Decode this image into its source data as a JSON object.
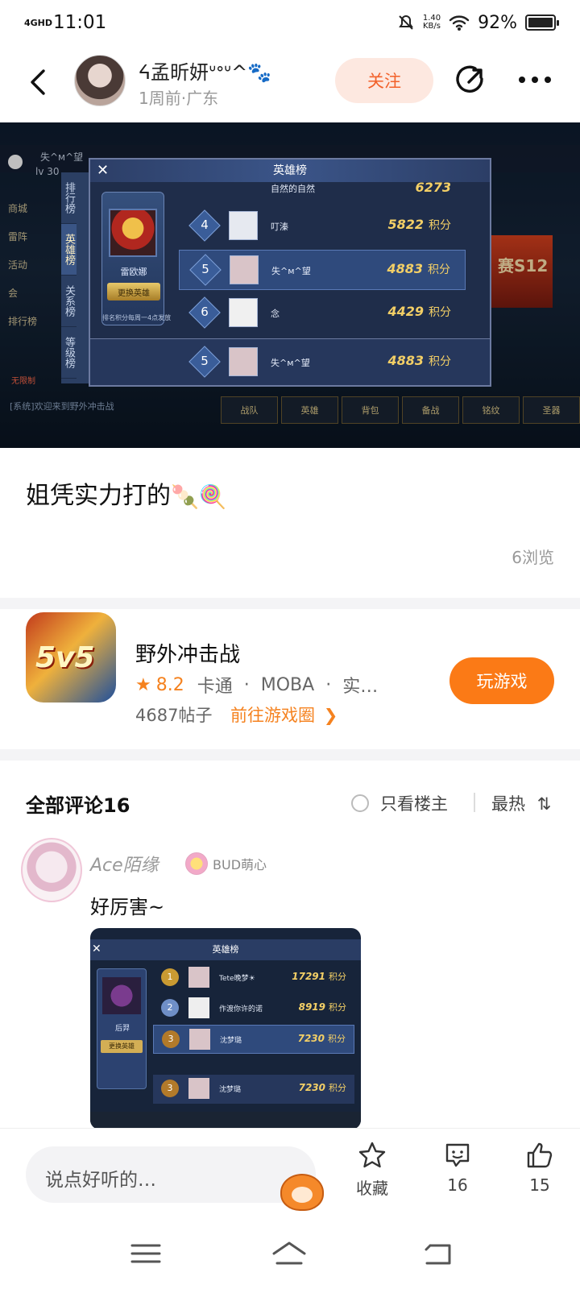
{
  "status_bar": {
    "network": "4GHD",
    "time": "11:01",
    "speed_value": "1.40",
    "speed_unit": "KB/s",
    "battery": "92%",
    "battery_level": 0.92
  },
  "header": {
    "user_name": "ᔦ孟昕妍ᐡᐤᐡ^🐾",
    "post_meta": "1周前·广东",
    "follow_label": "关注"
  },
  "game_shot": {
    "top_player": "失^м^望",
    "level": "lv 30",
    "side_tabs": [
      "排行榜",
      "英雄榜",
      "关系榜",
      "等级榜"
    ],
    "panel_title": "英雄榜",
    "hero_name": "雷欧娜",
    "swap_hero": "更换英雄",
    "rank_note": "排名积分每周一4点发放",
    "top_row_name": "自然的自然",
    "top_row_score": "6273",
    "rows": [
      {
        "rank": "4",
        "name": "叮溱",
        "score": "5822",
        "unit": "积分"
      },
      {
        "rank": "5",
        "name": "失^м^望",
        "score": "4883",
        "unit": "积分"
      },
      {
        "rank": "6",
        "name": "念",
        "score": "4429",
        "unit": "积分"
      }
    ],
    "my_row": {
      "rank": "5",
      "name": "失^м^望",
      "score": "4883",
      "unit": "积分"
    },
    "left_nav": [
      "商城",
      "雷阵",
      "活动",
      "会",
      "排行榜"
    ],
    "promo": "赛S12",
    "promo_sub": "赛",
    "chat_sys": "无限制",
    "chat_line": "[系统]欢迎来到野外冲击战",
    "bottom_tabs": [
      "战队",
      "英雄",
      "背包",
      "备战",
      "铭纹",
      "圣器"
    ]
  },
  "post": {
    "text": "姐凭实力打的",
    "views": "6浏览"
  },
  "game_card": {
    "name": "野外冲击战",
    "icon_text": "5v5",
    "rating": "8.2",
    "tags": [
      "卡通",
      "MOBA",
      "实…"
    ],
    "posts": "4687帖子",
    "circle_link": "前往游戏圈",
    "play_label": "玩游戏"
  },
  "comments": {
    "title": "全部评论16",
    "only_owner": "只看楼主",
    "sort": "最热",
    "items": [
      {
        "user": "Ace陌缘",
        "badge": "BUD萌心",
        "text": "好厉害~",
        "image": {
          "title": "英雄榜",
          "hero_name": "后羿",
          "swap": "更换英雄",
          "rows": [
            {
              "rank": "1",
              "name": "Tete晚梦☀",
              "score": "17291",
              "unit": "积分"
            },
            {
              "rank": "2",
              "name": "作渡你许的诺",
              "score": "8919",
              "unit": "积分"
            },
            {
              "rank": "3",
              "name": "沈梦璐",
              "score": "7230",
              "unit": "积分"
            }
          ],
          "my_row": {
            "rank": "3",
            "name": "沈梦璐",
            "score": "7230",
            "unit": "积分"
          }
        }
      }
    ]
  },
  "bottom_bar": {
    "placeholder": "说点好听的…",
    "favorite_label": "收藏",
    "comment_count": "16",
    "like_count": "15"
  }
}
